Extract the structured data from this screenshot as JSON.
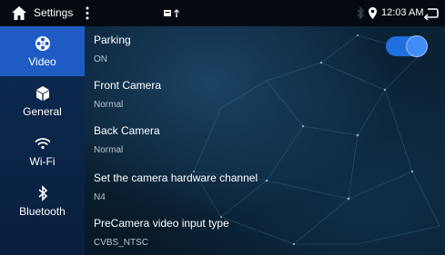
{
  "statusbar": {
    "title": "Settings",
    "time": "12:03 AM"
  },
  "sidebar": {
    "items": [
      {
        "label": "Video",
        "icon": "film-reel-icon",
        "active": true
      },
      {
        "label": "General",
        "icon": "cube-icon",
        "active": false
      },
      {
        "label": "Wi-Fi",
        "icon": "wifi-icon",
        "active": false
      },
      {
        "label": "Bluetooth",
        "icon": "bluetooth-icon",
        "active": false
      }
    ]
  },
  "settings": [
    {
      "label": "Parking",
      "value": "ON",
      "toggle": true
    },
    {
      "label": "Front Camera",
      "value": "Normal"
    },
    {
      "label": "Back Camera",
      "value": "Normal"
    },
    {
      "label": "Set the camera hardware channel",
      "value": "N4"
    },
    {
      "label": "PreCamera video input type",
      "value": "CVBS_NTSC"
    }
  ],
  "colors": {
    "accent": "#1e5cc4",
    "toggle_on": "#1f6fe0"
  }
}
